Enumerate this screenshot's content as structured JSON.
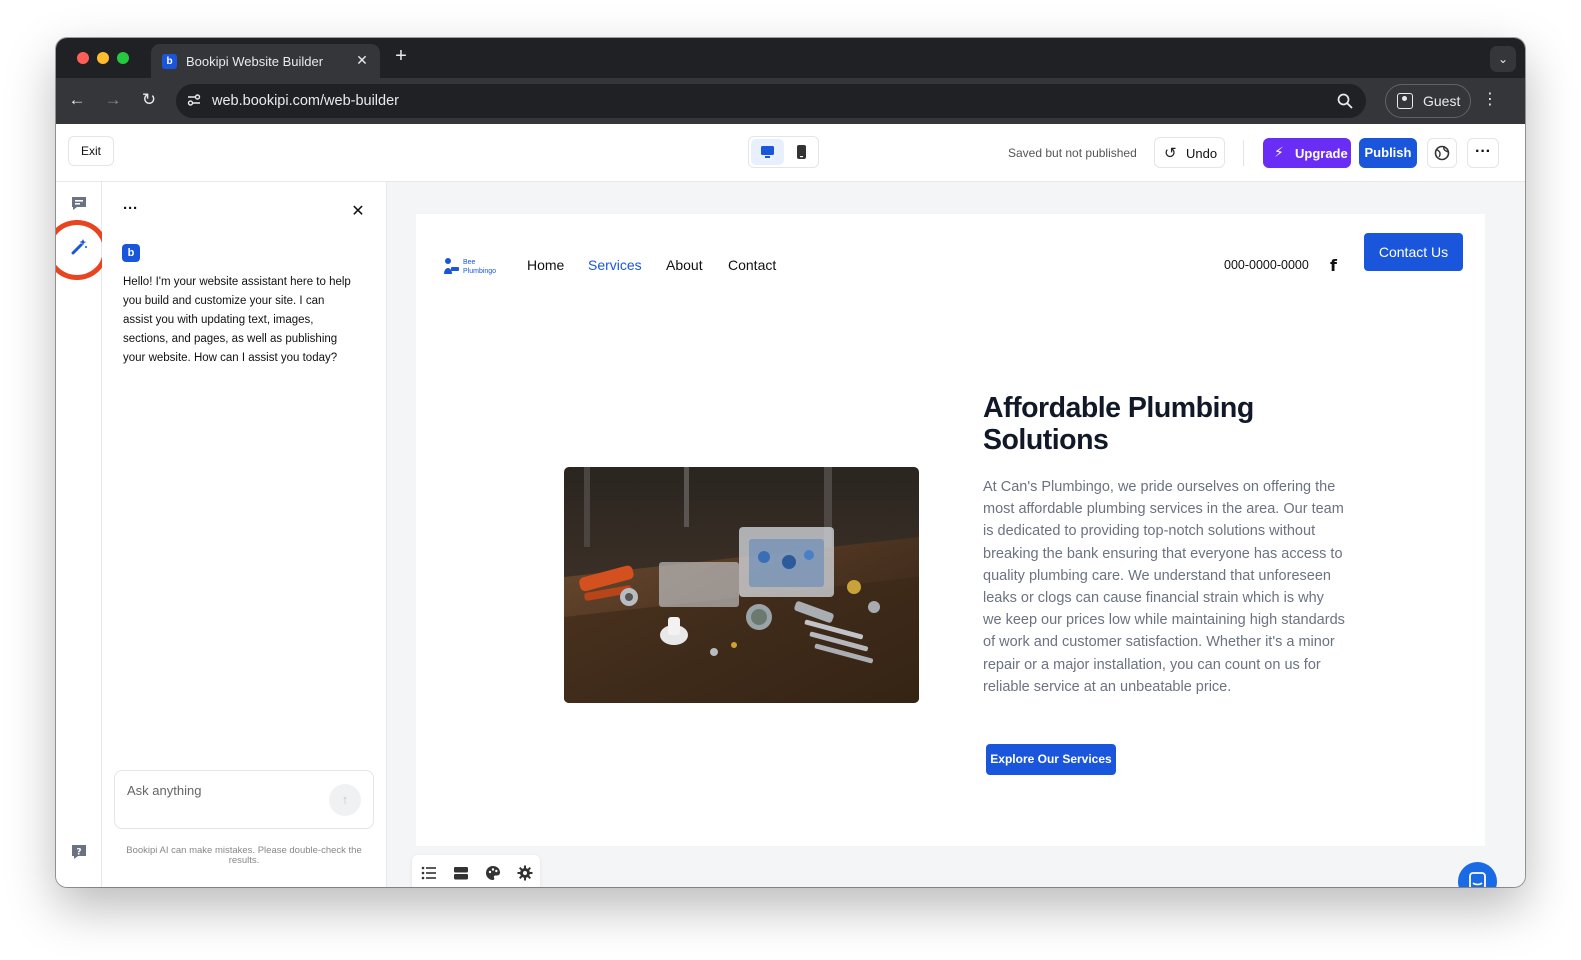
{
  "browser": {
    "tab_title": "Bookipi Website Builder",
    "favicon_letter": "b",
    "close_glyph": "✕",
    "newtab_glyph": "+",
    "tabsearch_glyph": "⌄",
    "url": "web.bookipi.com/web-builder",
    "profile_label": "Guest",
    "menu_glyph": "⋮",
    "back_glyph": "←",
    "forward_glyph": "→",
    "reload_glyph": "↻"
  },
  "builder_header": {
    "exit_label": "Exit",
    "save_status": "Saved but not published",
    "undo_label": "Undo",
    "undo_glyph": "↺",
    "upgrade_label": "Upgrade",
    "upgrade_glyph": "⚡",
    "publish_label": "Publish",
    "more_glyph": "···",
    "active_device": "desktop",
    "accent_color": "#1a56db",
    "upgrade_color": "#6a2df5"
  },
  "ai_panel": {
    "menu_glyph": "···",
    "close_glyph": "✕",
    "avatar_letter": "b",
    "assistant_message": "Hello! I'm your website assistant here to help you build and customize your site. I can assist you with updating text, images, sections, and pages, as well as publishing your website. How can I assist you today?",
    "input_placeholder": "Ask anything",
    "send_glyph": "↑",
    "disclaimer": "Bookipi AI can make mistakes. Please double-check the results."
  },
  "site": {
    "nav": {
      "items": [
        {
          "label": "Home",
          "active": false
        },
        {
          "label": "Services",
          "active": true
        },
        {
          "label": "About",
          "active": false
        },
        {
          "label": "Contact",
          "active": false
        }
      ]
    },
    "logo_text_top": "Bee",
    "logo_text_bottom": "Plumbingo",
    "phone": "000-0000-0000",
    "facebook_glyph": "f",
    "contact_button": "Contact Us",
    "hero": {
      "title": "Affordable Plumbing Solutions",
      "body": "At Can's Plumbingo, we pride ourselves on offering the most affordable plumbing services in the area. Our team is dedicated to providing top-notch solutions without breaking the bank ensuring that everyone has access to quality plumbing care. We understand that unforeseen leaks or clogs can cause financial strain which is why we keep our prices low while maintaining high standards of work and customer satisfaction. Whether it's a minor repair or a major installation, you can count on us for reliable service at an unbeatable price.",
      "cta": "Explore Our Services"
    }
  }
}
